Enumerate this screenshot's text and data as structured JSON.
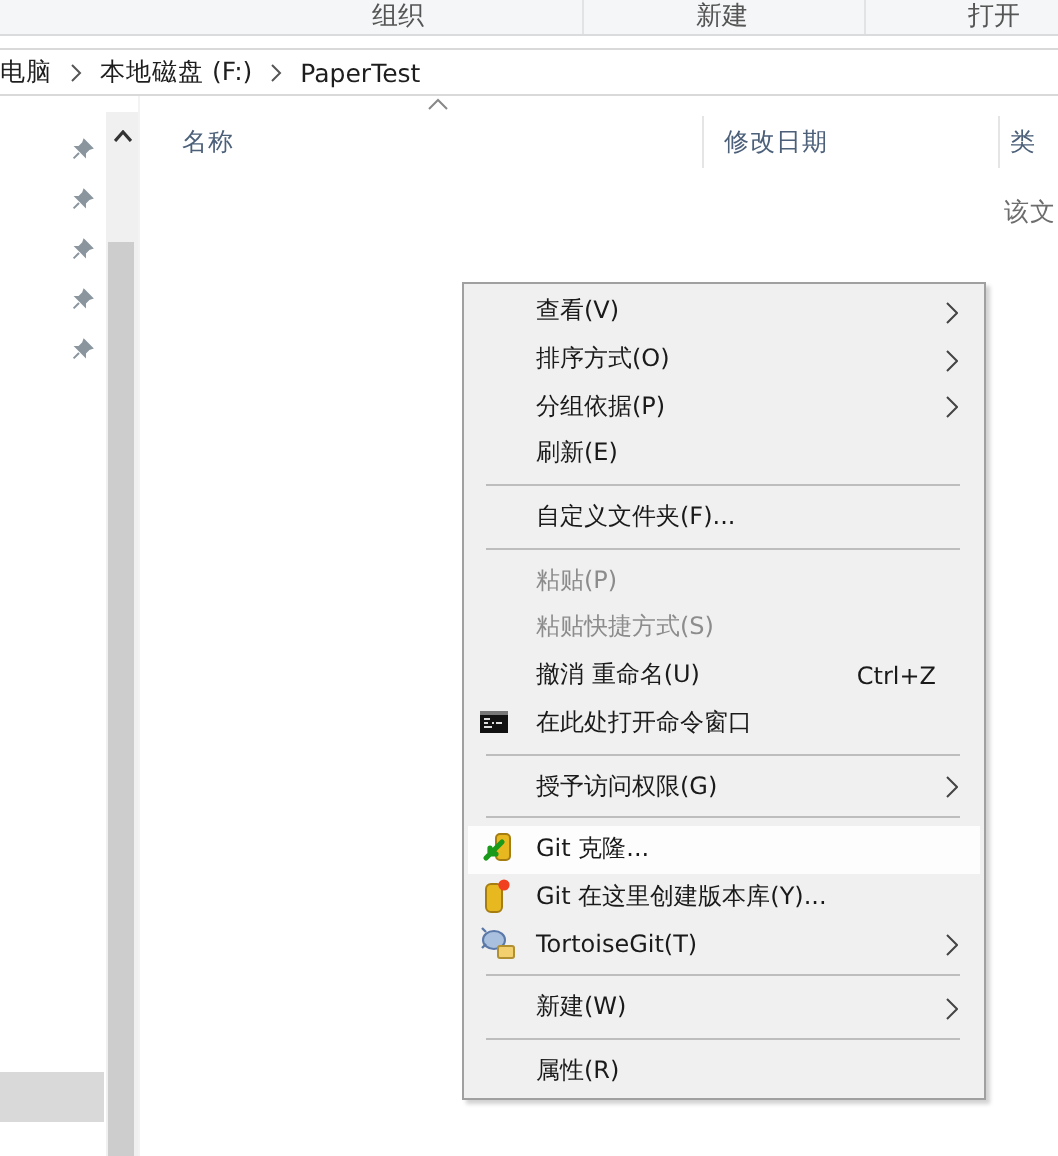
{
  "ribbon": {
    "groups": [
      "组织",
      "新建",
      "打开"
    ]
  },
  "address_bar": {
    "path": [
      {
        "label": "电脑"
      },
      {
        "label": "本地磁盘 (F:)"
      },
      {
        "label": "PaperTest"
      }
    ]
  },
  "nav_pane": {
    "items": [
      {
        "pinned": true,
        "selected": false
      },
      {
        "pinned": true,
        "selected": false
      },
      {
        "pinned": true,
        "selected": false
      },
      {
        "pinned": true,
        "selected": false
      },
      {
        "pinned": true,
        "selected": false
      },
      {
        "pinned": false,
        "selected": true
      }
    ]
  },
  "file_list": {
    "columns": [
      {
        "label": "名称",
        "sorted": true
      },
      {
        "label": "修改日期",
        "sorted": false
      },
      {
        "label": "类",
        "sorted": false
      }
    ],
    "empty_text": "该文"
  },
  "context_menu": {
    "items": [
      {
        "kind": "item",
        "label": "查看(V)",
        "submenu": true,
        "disabled": false,
        "selected": false
      },
      {
        "kind": "item",
        "label": "排序方式(O)",
        "submenu": true,
        "disabled": false,
        "selected": false
      },
      {
        "kind": "item",
        "label": "分组依据(P)",
        "submenu": true,
        "disabled": false,
        "selected": false
      },
      {
        "kind": "item",
        "label": "刷新(E)",
        "submenu": false,
        "disabled": false,
        "selected": false
      },
      {
        "kind": "separator"
      },
      {
        "kind": "item",
        "label": "自定义文件夹(F)...",
        "submenu": false,
        "disabled": false,
        "selected": false
      },
      {
        "kind": "separator"
      },
      {
        "kind": "item",
        "label": "粘贴(P)",
        "submenu": false,
        "disabled": true,
        "selected": false
      },
      {
        "kind": "item",
        "label": "粘贴快捷方式(S)",
        "submenu": false,
        "disabled": true,
        "selected": false
      },
      {
        "kind": "item",
        "label": "撤消 重命名(U)",
        "shortcut": "Ctrl+Z",
        "submenu": false,
        "disabled": false,
        "selected": false
      },
      {
        "kind": "item",
        "label": "在此处打开命令窗口",
        "submenu": false,
        "disabled": false,
        "selected": false
      },
      {
        "kind": "separator"
      },
      {
        "kind": "item",
        "label": "授予访问权限(G)",
        "submenu": true,
        "disabled": false,
        "selected": false
      },
      {
        "kind": "separator"
      },
      {
        "kind": "item",
        "label": "Git 克隆...",
        "submenu": false,
        "disabled": false,
        "selected": true
      },
      {
        "kind": "item",
        "label": "Git 在这里创建版本库(Y)...",
        "submenu": false,
        "disabled": false,
        "selected": false
      },
      {
        "kind": "item",
        "label": "TortoiseGit(T)",
        "submenu": true,
        "disabled": false,
        "selected": false
      },
      {
        "kind": "separator"
      },
      {
        "kind": "item",
        "label": "新建(W)",
        "submenu": true,
        "disabled": false,
        "selected": false
      },
      {
        "kind": "separator"
      },
      {
        "kind": "item",
        "label": "属性(R)",
        "submenu": false,
        "disabled": false,
        "selected": false
      }
    ]
  }
}
